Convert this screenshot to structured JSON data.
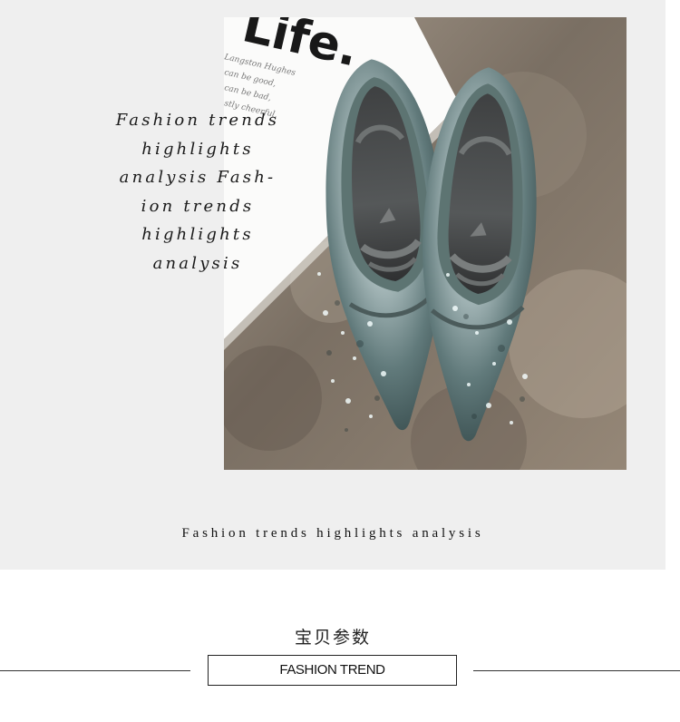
{
  "hero": {
    "photo_icon": "sparkly-pointed-flat-shoes-photo",
    "card_word": "Life.",
    "card_lines": [
      "Langston Hughes",
      "can be good,",
      "can be bad,",
      "stly cheerful,"
    ],
    "overlay_text_lines": [
      "Fashion trends",
      "highlights",
      "analysis Fash-",
      "ion trends",
      "highlights",
      "analysis"
    ],
    "caption": "Fashion trends highlights analysis"
  },
  "section": {
    "title": "宝贝参数",
    "badge_label": "FASHION TREND"
  },
  "colors": {
    "hero_background": "#efefef",
    "divider": "#333333",
    "text": "#111111"
  }
}
